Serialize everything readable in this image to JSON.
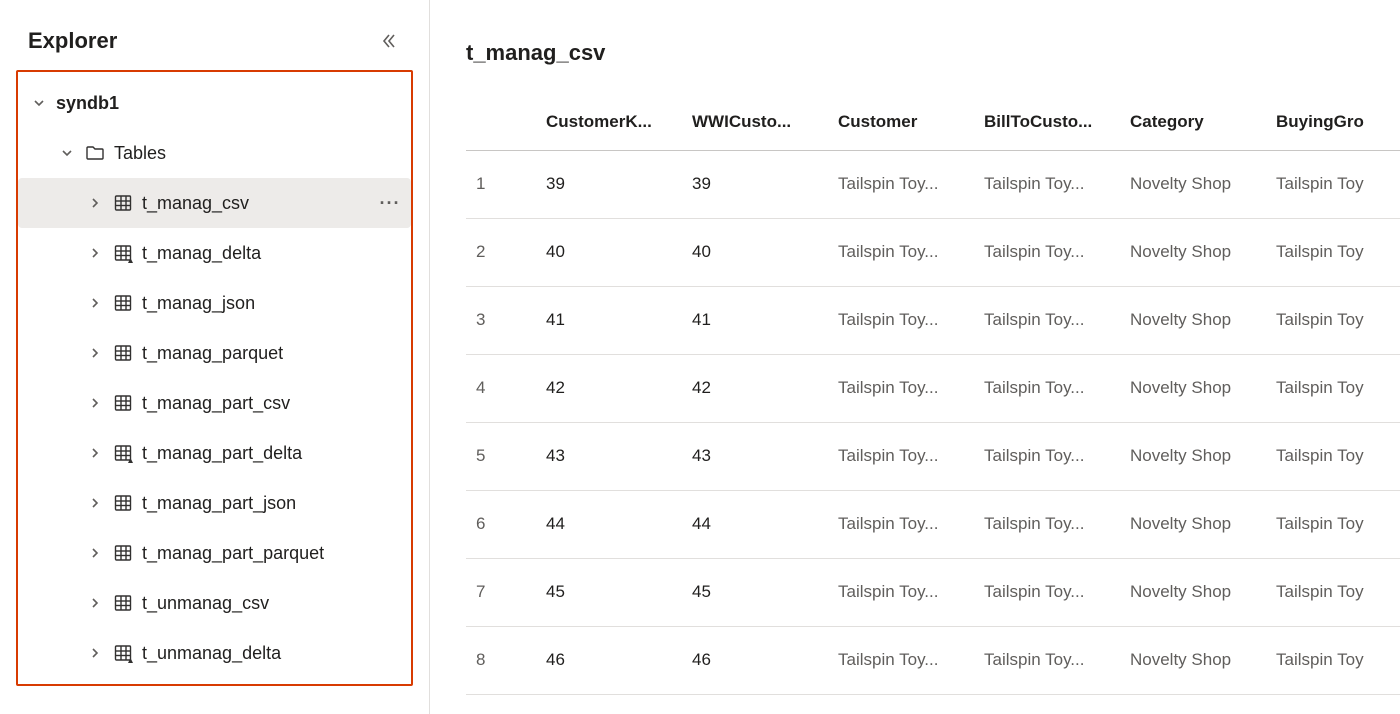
{
  "sidebar": {
    "title": "Explorer",
    "database": "syndb1",
    "folder": "Tables",
    "tables": [
      {
        "name": "t_manag_csv",
        "delta": false
      },
      {
        "name": "t_manag_delta",
        "delta": true
      },
      {
        "name": "t_manag_json",
        "delta": false
      },
      {
        "name": "t_manag_parquet",
        "delta": false
      },
      {
        "name": "t_manag_part_csv",
        "delta": false
      },
      {
        "name": "t_manag_part_delta",
        "delta": true
      },
      {
        "name": "t_manag_part_json",
        "delta": false
      },
      {
        "name": "t_manag_part_parquet",
        "delta": false
      },
      {
        "name": "t_unmanag_csv",
        "delta": false
      },
      {
        "name": "t_unmanag_delta",
        "delta": true
      }
    ],
    "selected_index": 0,
    "more_label": "···"
  },
  "main": {
    "title": "t_manag_csv",
    "columns": [
      "CustomerK...",
      "WWICusto...",
      "Customer",
      "BillToCusto...",
      "Category",
      "BuyingGro"
    ],
    "row_numbers": [
      "1",
      "2",
      "3",
      "4",
      "5",
      "6",
      "7",
      "8"
    ],
    "rows": [
      [
        "39",
        "39",
        "Tailspin Toy...",
        "Tailspin Toy...",
        "Novelty Shop",
        "Tailspin Toy"
      ],
      [
        "40",
        "40",
        "Tailspin Toy...",
        "Tailspin Toy...",
        "Novelty Shop",
        "Tailspin Toy"
      ],
      [
        "41",
        "41",
        "Tailspin Toy...",
        "Tailspin Toy...",
        "Novelty Shop",
        "Tailspin Toy"
      ],
      [
        "42",
        "42",
        "Tailspin Toy...",
        "Tailspin Toy...",
        "Novelty Shop",
        "Tailspin Toy"
      ],
      [
        "43",
        "43",
        "Tailspin Toy...",
        "Tailspin Toy...",
        "Novelty Shop",
        "Tailspin Toy"
      ],
      [
        "44",
        "44",
        "Tailspin Toy...",
        "Tailspin Toy...",
        "Novelty Shop",
        "Tailspin Toy"
      ],
      [
        "45",
        "45",
        "Tailspin Toy...",
        "Tailspin Toy...",
        "Novelty Shop",
        "Tailspin Toy"
      ],
      [
        "46",
        "46",
        "Tailspin Toy...",
        "Tailspin Toy...",
        "Novelty Shop",
        "Tailspin Toy"
      ]
    ]
  }
}
